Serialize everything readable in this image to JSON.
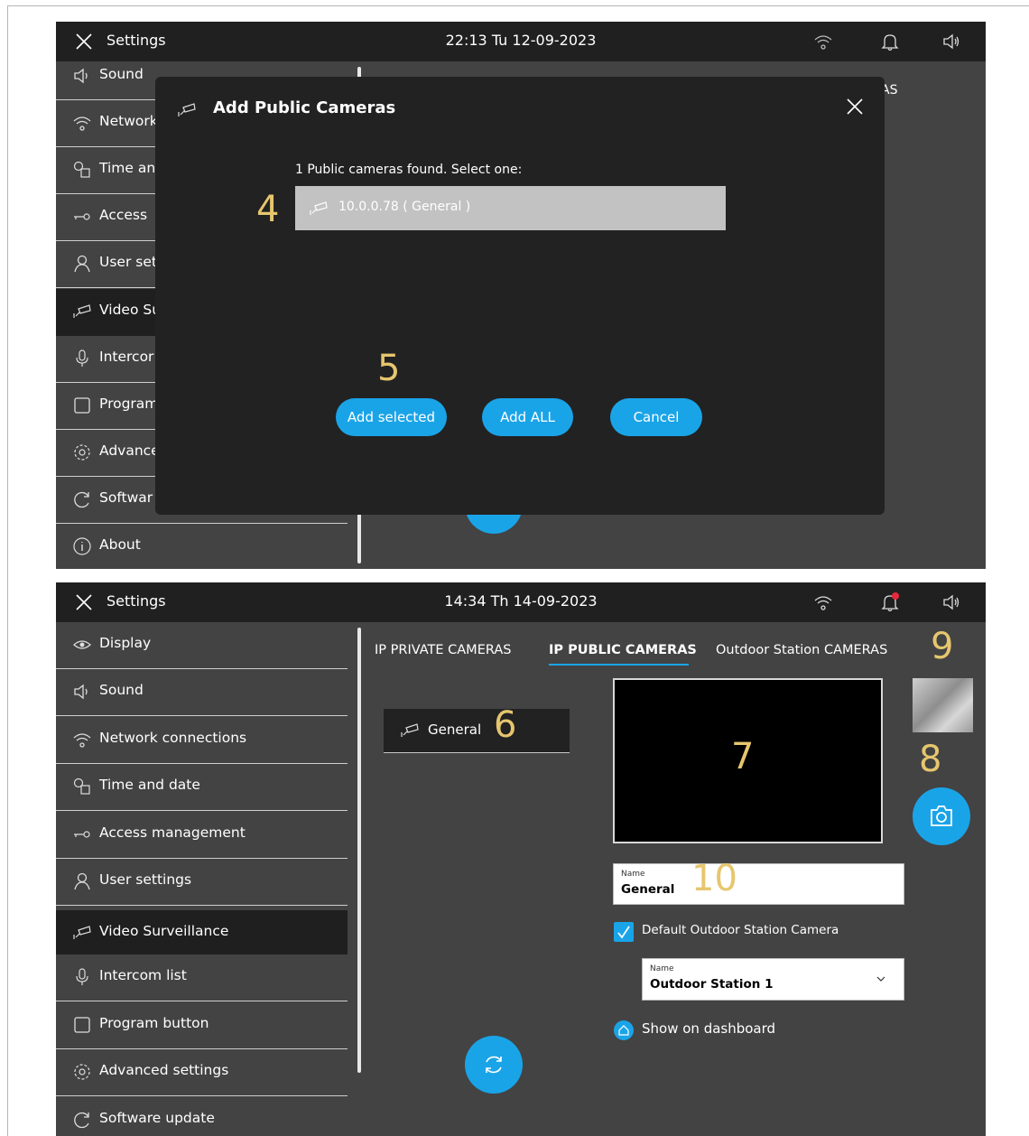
{
  "screen1": {
    "title": "Settings",
    "clock": "22:13  Tu 12-09-2023",
    "sidebar": [
      "Sound",
      "Network",
      "Time an",
      "Access",
      "User set",
      "Video Su",
      "Intercor",
      "Program",
      "Advance",
      "Softwar",
      "About"
    ],
    "behind_tab_fragment": "AS",
    "dialog": {
      "title": "Add Public Cameras",
      "found_text": "1 Public cameras found. Select one:",
      "camera_row": "10.0.0.78 ( General )",
      "buttons": {
        "add_selected": "Add selected",
        "add_all": "Add ALL",
        "cancel": "Cancel"
      }
    },
    "annotations": {
      "a4": "4",
      "a5": "5"
    }
  },
  "screen2": {
    "title": "Settings",
    "clock": "14:34  Th 14-09-2023",
    "sidebar": [
      "Display",
      "Sound",
      "Network connections",
      "Time and date",
      "Access  management",
      "User settings",
      "Video Surveillance",
      "Intercom list",
      "Program button",
      "Advanced settings",
      "Software update"
    ],
    "tabs": [
      "IP PRIVATE CAMERAS",
      "IP PUBLIC CAMERAS",
      "Outdoor Station CAMERAS"
    ],
    "camera_list": [
      "General"
    ],
    "name_field": {
      "label": "Name",
      "value": "General"
    },
    "default_checkbox_label": "Default Outdoor Station Camera",
    "station_select": {
      "label": "Name",
      "value": "Outdoor Station 1"
    },
    "dashboard_label": "Show on dashboard",
    "annotations": {
      "a6": "6",
      "a7": "7",
      "a8": "8",
      "a9": "9",
      "a10": "10"
    }
  },
  "colors": {
    "accent": "#1aa4e8",
    "topbar": "#202020",
    "panel": "#434343",
    "annotation": "#e6c66e"
  }
}
